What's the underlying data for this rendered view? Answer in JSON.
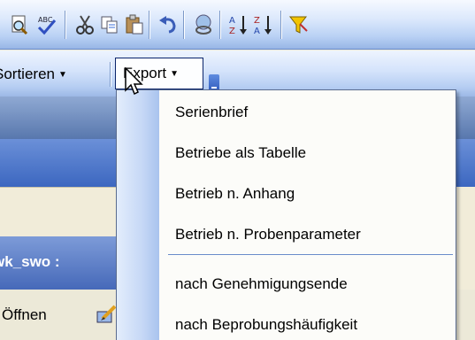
{
  "toolbar_icons": [
    {
      "name": "print-preview-icon"
    },
    {
      "name": "spellcheck-icon"
    },
    {
      "name": "cut-icon"
    },
    {
      "name": "copy-icon"
    },
    {
      "name": "paste-icon"
    },
    {
      "name": "undo-icon"
    },
    {
      "name": "hyperlink-icon"
    },
    {
      "name": "sort-ascending-icon"
    },
    {
      "name": "sort-descending-icon"
    },
    {
      "name": "filter-icon"
    }
  ],
  "menubar": {
    "sort_label": "Sortieren",
    "export_label": "Export"
  },
  "background": {
    "record_label": "wk_swo :",
    "open_label": "Öffnen"
  },
  "dropdown": {
    "items": [
      {
        "label": "Serienbrief"
      },
      {
        "label": "Betriebe als Tabelle"
      },
      {
        "label": "Betrieb n. Anhang"
      },
      {
        "label": "Betrieb n. Probenparameter"
      },
      {
        "label": "nach Genehmigungsende"
      },
      {
        "label": "nach Beprobungshäufigkeit"
      }
    ]
  },
  "colors": {
    "menu_border": "#0a246a",
    "gutter": "#c6d8f6",
    "toolbar": "#b9d1f4"
  }
}
